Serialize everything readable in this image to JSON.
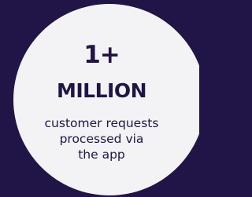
{
  "stat": {
    "number": "1+",
    "unit": "MILLION",
    "caption_lines": [
      "customer requests",
      "processed via",
      "the app"
    ]
  },
  "colors": {
    "background": "#211446",
    "circle": "#f3f3f5",
    "text": "#211446"
  }
}
